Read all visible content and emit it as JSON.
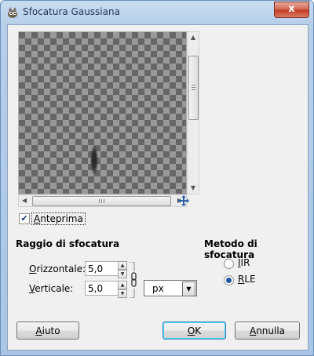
{
  "window": {
    "title": "Sfocatura Gaussiana",
    "close_label": "x"
  },
  "preview": {
    "toggle_label": "Anteprima",
    "toggle_checked": true
  },
  "radius": {
    "title": "Raggio di sfocatura",
    "horizontal_label": "Orizzontale:",
    "horizontal_value": "5,0",
    "vertical_label": "Verticale:",
    "vertical_value": "5,0",
    "unit": "px"
  },
  "method": {
    "title": "Metodo di sfocatura",
    "options": [
      {
        "label": "IIR",
        "selected": false
      },
      {
        "label": "RLE",
        "selected": true
      }
    ]
  },
  "buttons": {
    "help": "Aiuto",
    "ok": "OK",
    "cancel": "Annulla"
  },
  "icons": {
    "app": "gimp-wilber-icon",
    "navigate": "move-cross-icon",
    "chain": "chain-link-icon"
  }
}
